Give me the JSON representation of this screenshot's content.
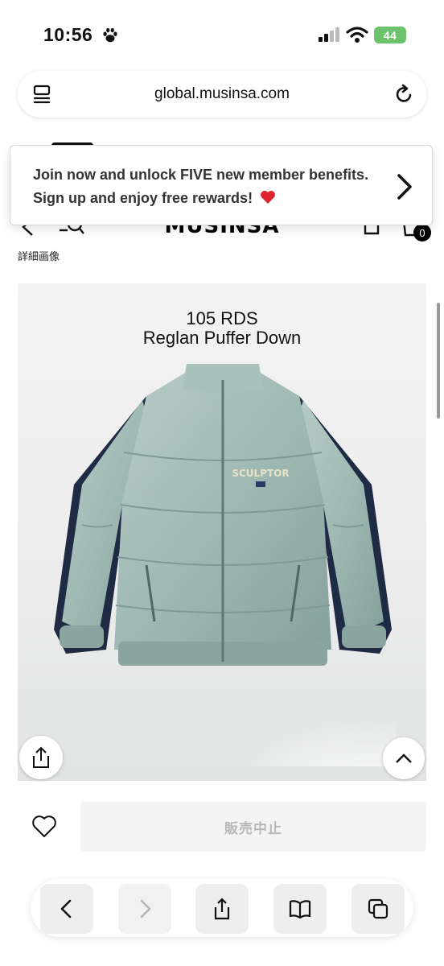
{
  "status_bar": {
    "time": "10:56",
    "battery": "44"
  },
  "browser": {
    "url": "global.musinsa.com"
  },
  "banner": {
    "message": "Join now and unlock FIVE new member benefits. Sign up and enjoy free rewards!"
  },
  "header": {
    "logo": "MUSINSA",
    "cart_count": "0",
    "sub_text": "詳細画像"
  },
  "product": {
    "title_line1": "105 RDS",
    "title_line2": "Reglan Puffer Down",
    "chest_logo": "SCULPTOR"
  },
  "purchase": {
    "buy_label": "販売中止"
  },
  "colors": {
    "accent": "#000000",
    "jacket": "#9fb9b3",
    "jacket_sleeve_stripe": "#1f2a44",
    "heart": "#e0242d",
    "battery": "#6cc36c"
  }
}
